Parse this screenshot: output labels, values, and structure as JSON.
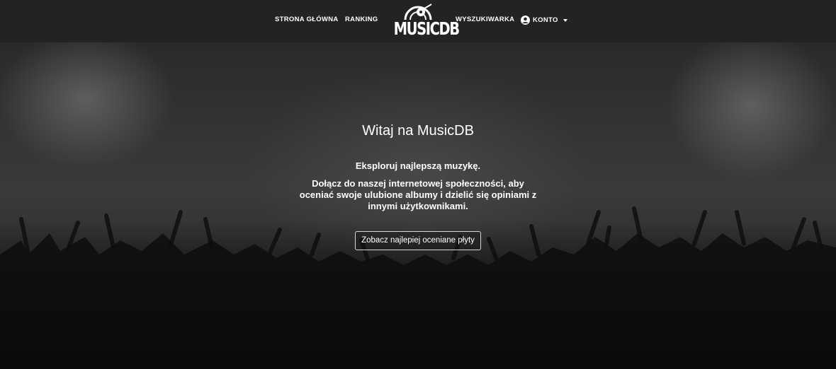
{
  "nav": {
    "home": "STRONA GŁÓWNA",
    "ranking": "RANKING",
    "logo_text": "MUSICDB",
    "search": "WYSZUKIWARKA",
    "account": "KONTO",
    "icons": {
      "account": "user-circle-icon",
      "dropdown": "caret-down-icon",
      "logo": "vinyl-record-icon"
    }
  },
  "hero": {
    "title": "Witaj na MusicDB",
    "lead": "Eksploruj najlepszą muzykę.",
    "description": "Dołącz do naszej internetowej społeczności, aby oceniać swoje ulubione albumy i dzielić się opiniami z innymi użytkownikami.",
    "button_label": "Zobacz najlepiej oceniane płyty"
  },
  "colors": {
    "navbar": "#232323",
    "text": "#ffffff",
    "button_border": "#d8d8d8"
  }
}
